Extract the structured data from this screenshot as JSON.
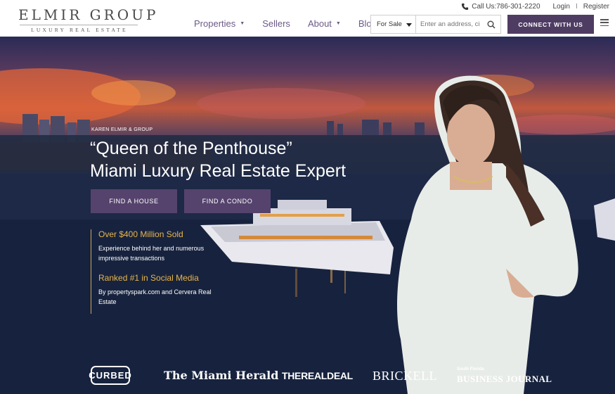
{
  "header": {
    "logo_main": "ELMIR GROUP",
    "logo_sub": "LUXURY REAL ESTATE",
    "call_label": "Call Us:786-301-2220",
    "login_label": "Login",
    "separator": "I",
    "register_label": "Register",
    "nav": [
      {
        "label": "Properties",
        "has_dropdown": true
      },
      {
        "label": "Sellers",
        "has_dropdown": false
      },
      {
        "label": "About",
        "has_dropdown": true
      },
      {
        "label": "Blog",
        "has_dropdown": false
      }
    ],
    "search": {
      "type_selected": "For Sale",
      "placeholder": "Enter an address, ci"
    },
    "connect_label": "CONNECT WITH US",
    "icons": [
      "phone-icon",
      "search-icon",
      "menu-icon",
      "chevron-down-icon"
    ]
  },
  "hero": {
    "kicker": "KAREN ELMIR & GROUP",
    "headline_line1": "“Queen of the Penthouse”",
    "headline_line2": "Miami Luxury Real Estate Expert",
    "find_house_label": "FIND A HOUSE",
    "find_condo_label": "FIND A CONDO",
    "stats": [
      {
        "title": "Over $400 Million Sold",
        "description": "Experience behind her and numerous impressive transactions"
      },
      {
        "title": "Ranked #1 in Social Media",
        "description": "By propertyspark.com and Cervera Real Estate"
      }
    ]
  },
  "press": {
    "curbed": "CURBED",
    "herald": "The Miami Herald",
    "realdeal": "THEREALDEAL",
    "brickell": "BRICKELL",
    "sfbj_small": "South Florida",
    "sfbj": "BUSINESS JOURNAL"
  },
  "colors": {
    "brand_purple": "#4f3c63",
    "nav_text": "#6b5a87",
    "hero_button": "#55436d",
    "stat_gold": "#e8b54a"
  }
}
